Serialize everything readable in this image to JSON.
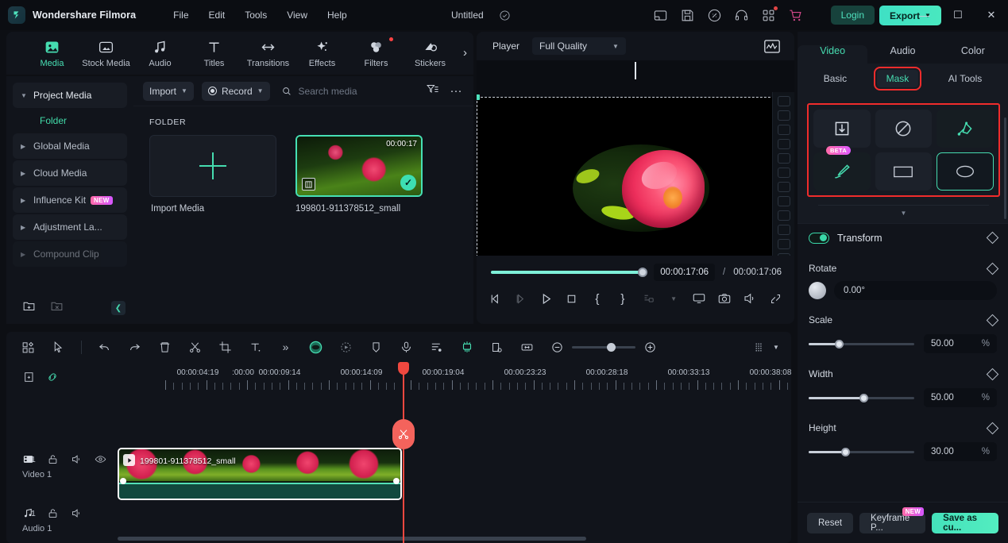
{
  "titlebar": {
    "brand": "Wondershare Filmora",
    "menus": [
      "File",
      "Edit",
      "Tools",
      "View",
      "Help"
    ],
    "document_title": "Untitled",
    "login_label": "Login",
    "export_label": "Export",
    "icons": [
      "layout-icon",
      "save-icon",
      "cloud-upload-icon",
      "headset-icon",
      "apps-grid-icon",
      "cart-icon"
    ],
    "window_buttons": {
      "minimize": "—",
      "maximize": "☐",
      "close": "✕"
    }
  },
  "function_tabs": [
    {
      "label": "Media",
      "icon": "media-icon",
      "active": true,
      "badge": false
    },
    {
      "label": "Stock Media",
      "icon": "stock-media-icon",
      "active": false,
      "badge": false
    },
    {
      "label": "Audio",
      "icon": "audio-note-icon",
      "active": false,
      "badge": false
    },
    {
      "label": "Titles",
      "icon": "titles-t-icon",
      "active": false,
      "badge": false
    },
    {
      "label": "Transitions",
      "icon": "transitions-arrow-icon",
      "active": false,
      "badge": false
    },
    {
      "label": "Effects",
      "icon": "effects-sparkle-icon",
      "active": false,
      "badge": false
    },
    {
      "label": "Filters",
      "icon": "filters-circles-icon",
      "active": false,
      "badge": true
    },
    {
      "label": "Stickers",
      "icon": "stickers-icon",
      "active": false,
      "badge": false
    }
  ],
  "sidebar": {
    "items": [
      {
        "label": "Project Media",
        "expanded": true,
        "badge": null
      },
      {
        "label": "Global Media",
        "expanded": false,
        "badge": null
      },
      {
        "label": "Cloud Media",
        "expanded": false,
        "badge": null
      },
      {
        "label": "Influence Kit",
        "expanded": false,
        "badge": "NEW"
      },
      {
        "label": "Adjustment La...",
        "expanded": false,
        "badge": null
      },
      {
        "label": "Compound Clip",
        "expanded": false,
        "badge": null
      }
    ],
    "selected_folder": "Folder",
    "footer_icons": [
      "new-folder-icon",
      "delete-folder-icon",
      "collapse-panel-icon"
    ]
  },
  "browser": {
    "import_label": "Import",
    "record_label": "Record",
    "search_placeholder": "Search media",
    "search_value": "",
    "filter_icon": "filter-icon",
    "more_icon": "more-options-icon",
    "section_label": "FOLDER",
    "import_cell_label": "Import Media",
    "media": [
      {
        "name": "199801-911378512_small",
        "duration": "00:00:17",
        "selected": true
      }
    ]
  },
  "player": {
    "title": "Player",
    "quality": "Full Quality",
    "scope_icon": "waveform-scope-icon",
    "current_time": "00:00:17:06",
    "separator": "/",
    "total_time": "00:00:17:06",
    "progress_percent": 98,
    "controls": [
      "prev-frame-icon",
      "next-frame-icon",
      "play-icon",
      "stop-icon",
      "mark-in-icon",
      "mark-out-icon",
      "snapshot-to-timeline-icon",
      "chevron-down-icon",
      "cast-icon",
      "camera-snapshot-icon",
      "volume-icon",
      "fullscreen-icon"
    ]
  },
  "right_panel": {
    "tabs": [
      {
        "label": "Video",
        "active": true
      },
      {
        "label": "Audio",
        "active": false
      },
      {
        "label": "Color",
        "active": false
      }
    ],
    "subtabs": [
      {
        "label": "Basic",
        "active": false,
        "highlighted": false
      },
      {
        "label": "Mask",
        "active": true,
        "highlighted": true
      },
      {
        "label": "AI Tools",
        "active": false,
        "highlighted": false
      }
    ],
    "mask_options": [
      {
        "name": "import-mask-icon",
        "selected": false,
        "badge": null,
        "accent": false
      },
      {
        "name": "no-mask-icon",
        "selected": false,
        "badge": null,
        "accent": false
      },
      {
        "name": "pen-mask-icon",
        "selected": false,
        "badge": null,
        "accent": true
      },
      {
        "name": "brush-mask-icon",
        "selected": false,
        "badge": "BETA",
        "accent": true
      },
      {
        "name": "rectangle-mask-icon",
        "selected": false,
        "badge": null,
        "accent": false
      },
      {
        "name": "ellipse-mask-icon",
        "selected": true,
        "badge": null,
        "accent": false
      }
    ],
    "transform": {
      "label": "Transform",
      "enabled": true,
      "properties": [
        {
          "label": "Rotate",
          "value": "0.00°",
          "unit": "",
          "percent": 0,
          "type": "dial"
        },
        {
          "label": "Scale",
          "value": "50.00",
          "unit": "%",
          "percent": 27,
          "type": "slider"
        },
        {
          "label": "Width",
          "value": "50.00",
          "unit": "%",
          "percent": 50,
          "type": "slider"
        },
        {
          "label": "Height",
          "value": "30.00",
          "unit": "%",
          "percent": 33,
          "type": "slider"
        }
      ]
    },
    "footer": {
      "reset_label": "Reset",
      "keyframe_label": "Keyframe P...",
      "keyframe_badge": "NEW",
      "save_label": "Save as cu..."
    }
  },
  "timeline_toolbar": {
    "icons": [
      "templates-icon",
      "select-tool-icon",
      "undo-icon",
      "redo-icon",
      "delete-icon",
      "split-scissors-icon",
      "crop-icon",
      "text-icon",
      "more-chevrons-icon",
      "color-match-icon",
      "motion-tracking-icon",
      "marker-icon",
      "voiceover-icon",
      "audio-mixer-icon",
      "green-screen-icon",
      "mask-timeline-icon",
      "fit-icon"
    ],
    "zoom_out_icon": "zoom-out-icon",
    "zoom_in_icon": "zoom-in-icon",
    "zoom_percent": 55,
    "render_icon": "render-preview-icon",
    "render_chevron": "chevron-down-icon"
  },
  "timeline": {
    "head_icons": [
      "add-track-icon",
      "link-icon"
    ],
    "ruler_labels": [
      ":00:00",
      "00:00:04:19",
      "00:00:09:14",
      "00:00:14:09",
      "00:00:19:04",
      "00:00:23:23",
      "00:00:28:18",
      "00:00:33:13",
      "00:00:38:08"
    ],
    "playhead_time": "00:00:17:06",
    "cut_icon": "scissors-icon",
    "tracks": [
      {
        "name": "Video 1",
        "number": "1",
        "type": "video",
        "icons": [
          "video-track-icon",
          "lock-icon",
          "mute-icon",
          "eye-icon"
        ]
      },
      {
        "name": "Audio 1",
        "number": "1",
        "type": "audio",
        "icons": [
          "audio-track-icon",
          "lock-icon",
          "mute-icon"
        ]
      }
    ],
    "clips": [
      {
        "name": "199801-911378512_small",
        "track": "Video 1",
        "selected": true
      }
    ]
  },
  "colors": {
    "accent": "#46dcb0",
    "highlight_box": "#f02c2c",
    "playhead": "#f0483f",
    "badge_new": "#ff6aa8",
    "panel_bg": "#11141b"
  }
}
